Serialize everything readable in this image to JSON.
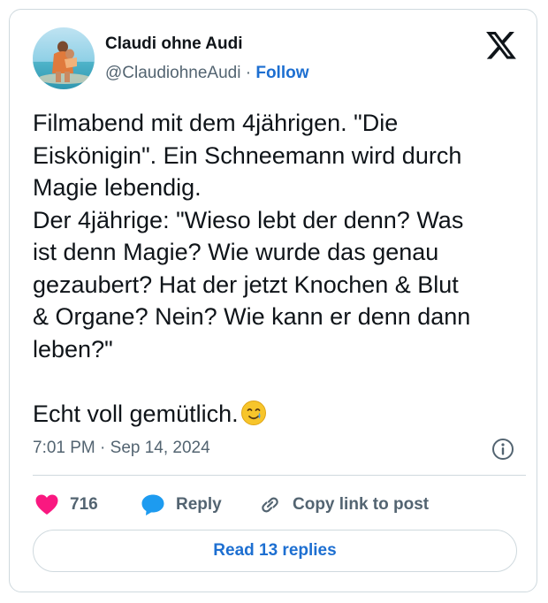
{
  "author": {
    "display_name": "Claudi ohne Audi",
    "handle": "@ClaudiohneAudi",
    "separator": " · ",
    "follow_label": "Follow"
  },
  "brand": {
    "logo_icon": "x-logo-icon"
  },
  "tweet": {
    "text": "Filmabend mit dem 4jährigen. \"Die\nEiskönigin\". Ein Schneemann wird durch\nMagie lebendig.\nDer 4jährige: \"Wieso lebt der denn? Was\nist denn Magie? Wie wurde das genau\ngezaubert? Hat der jetzt Knochen & Blut\n& Organe? Nein? Wie kann er denn dann\nleben?\"\n\nEcht voll gemütlich.",
    "emoji_icon": "smiling-face-with-tear-icon",
    "timestamp": "7:01 PM · Sep 14, 2024"
  },
  "actions": {
    "like_count": "716",
    "reply_label": "Reply",
    "copy_label": "Copy link to post"
  },
  "footer": {
    "read_replies_label": "Read 13 replies"
  },
  "colors": {
    "like": "#f91880",
    "reply": "#1d9bf0",
    "link": "#1d6fd1",
    "muted": "#536471",
    "border": "#cfd9de"
  }
}
